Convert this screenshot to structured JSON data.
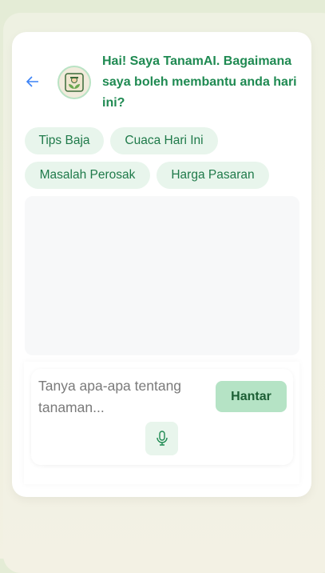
{
  "header": {
    "back_icon": "arrow-left-icon",
    "avatar_icon": "farmer-plant-icon",
    "title": "Hai! Saya TanamAI. Bagaimana saya boleh membantu anda hari ini?"
  },
  "suggestions": [
    "Tips Baja",
    "Cuaca Hari Ini",
    "Masalah Perosak",
    "Harga Pasaran"
  ],
  "input": {
    "placeholder": "Tanya apa-apa tentang tanaman...",
    "value": "",
    "send_label": "Hantar",
    "mic_icon": "microphone-icon"
  },
  "colors": {
    "accent": "#1f8a52",
    "chip_bg": "#e8f5ec",
    "send_bg": "#b5e3c5"
  }
}
